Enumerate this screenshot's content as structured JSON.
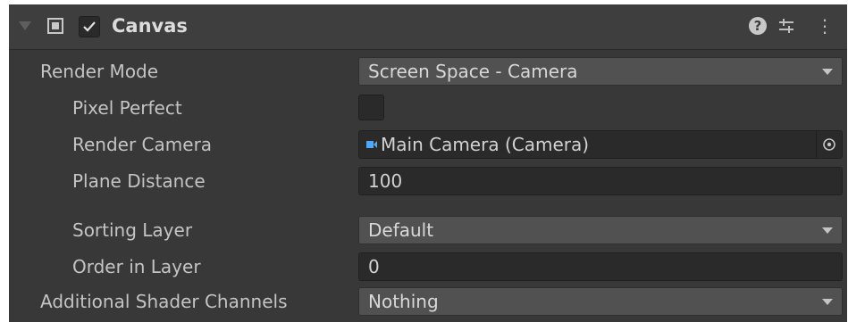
{
  "component": {
    "title": "Canvas",
    "enabled": true,
    "icons": [
      "canvas-icon",
      "help-icon",
      "presets-icon",
      "more-icon"
    ],
    "help_glyph": "?",
    "more_glyph": "⋮"
  },
  "properties": {
    "render_mode": {
      "label": "Render Mode",
      "value": "Screen Space - Camera"
    },
    "pixel_perfect": {
      "label": "Pixel Perfect",
      "checked": false
    },
    "render_camera": {
      "label": "Render Camera",
      "value": "Main Camera (Camera)"
    },
    "plane_distance": {
      "label": "Plane Distance",
      "value": "100"
    },
    "sorting_layer": {
      "label": "Sorting Layer",
      "value": "Default"
    },
    "order_in_layer": {
      "label": "Order in Layer",
      "value": "0"
    },
    "additional_shader_channels": {
      "label": "Additional Shader Channels",
      "value": "Nothing"
    }
  },
  "colors": {
    "panel_bg": "#383838",
    "header_bg": "#3e3e3e",
    "popup_bg": "#515151",
    "field_bg": "#2a2a2a",
    "text": "#c4c4c4",
    "camera_icon": "#4ea8f5"
  }
}
